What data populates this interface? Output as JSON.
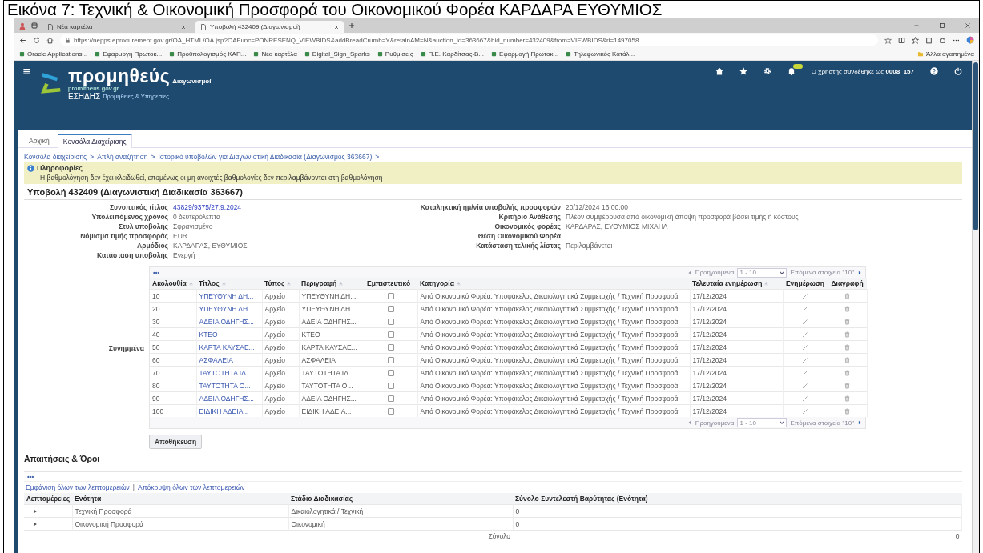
{
  "caption": "Εικόνα 7: Τεχνική & Οικονομική Προσφορά του Οικονομικού Φορέα ΚΑΡΔΑΡΑ ΕΥΘΥΜΙΟΣ",
  "browser": {
    "tabs": [
      {
        "title": "Νέα καρτέλα",
        "selected": false
      },
      {
        "title": "Υποβολή 432409 (Διαγωνισμοί)",
        "selected": true
      }
    ],
    "url": "https://nepps.eprocurement.gov.gr/OA_HTML/OA.jsp?OAFunc=PONRESENQ_VIEWBIDS&addBreadCrumb=Y&retainAM=N&auction_id=363667&bid_number=432409&from=VIEWBIDS&ri=1497058...",
    "bookmarks": [
      "Oracle Applications...",
      "Εφαρμογή Πρωτοκ...",
      "Προϋπολογισμός ΚΑΠ...",
      "Νέα καρτέλα",
      "Digital_Sign_Sparks",
      "Ρυθμίσεις",
      "Π.Ε. Καρδίτσας-Β...",
      "Εφαρμογή Πρωτοκ...",
      "Τηλεφωνικός Κατάλ..."
    ],
    "other_bookmarks": "Άλλα αγαπημένα"
  },
  "app": {
    "logo": "προμηθεύς",
    "logo_section": "Διαγωνισμοί",
    "logo_site": "promitheus.gov.gr",
    "logo_org": "ΕΣΗΔΗΣ",
    "logo_org_sub": "Προμήθειες & Υπηρεσίες",
    "user_text": "Ο χρήστης συνδέθηκε ως",
    "user_id": "0008_157"
  },
  "nav_tabs": [
    {
      "label": "Αρχική",
      "selected": false
    },
    {
      "label": "Κονσόλα Διαχείρισης",
      "selected": true
    }
  ],
  "breadcrumb": {
    "separator": ">",
    "items": [
      "Κονσόλα διαχείρισης",
      "Απλή αναζήτηση",
      "Ιστορικό υποβολών για Διαγωνιστική Διαδικασία (Διαγωνισμός 363667)"
    ]
  },
  "info": {
    "title": "Πληροφορίες",
    "message": "Η βαθμολόγηση δεν έχει κλειδωθεί, επομένως οι μη ανοιχτές βαθμολογίες δεν περιλαμβάνονται στη βαθμολόγηση"
  },
  "heading": "Υποβολή 432409 (Διαγωνιστική Διαδικασία 363667)",
  "details_left": [
    {
      "label": "Συνοπτικός τίτλος",
      "value": "43829/9375/27.9.2024",
      "kind": "link"
    },
    {
      "label": "Υπολειπόμενος χρόνος",
      "value": "0 δευτερόλεπτα",
      "kind": "text"
    },
    {
      "label": "Στυλ υποβολής",
      "value": "Σφραγισμένο",
      "kind": "text"
    },
    {
      "label": "Νόμισμα τιμής προσφοράς",
      "value": "EUR",
      "kind": "text"
    },
    {
      "label": "Αρμόδιος",
      "value": "ΚΑΡΔΑΡΑΣ, ΕΥΘΥΜΙΟΣ",
      "kind": "text"
    },
    {
      "label": "Κατάσταση υποβολής",
      "value": "Ενεργή",
      "kind": "text"
    }
  ],
  "details_right": [
    {
      "label": "Καταληκτική ημ/νία υποβολής προσφορών",
      "value": "20/12/2024 16:00:00",
      "kind": "text"
    },
    {
      "label": "Κριτήριο Ανάθεσης",
      "value": "Πλέον συμφέρουσα από οικονομική άποψη προσφορά βάσει τιμής ή κόστους",
      "kind": "text"
    },
    {
      "label": "Οικονομικός φορέας",
      "value": "ΚΑΡΔΑΡΑΣ, ΕΥΘΥΜΙΟΣ ΜΙΧΑΗΛ",
      "kind": "text"
    },
    {
      "label": "Θέση Οικονομικού Φορέα"
    },
    {
      "label": "Κατάσταση τελικής λίστας",
      "value": "Περιλαμβάνεται",
      "kind": "text"
    }
  ],
  "attachments": {
    "label": "Συνημμένα",
    "menu": "•••",
    "pager_top": {
      "previous": "Προηγούμενα",
      "range": "1 - 10",
      "next": "Επόμενα στοιχεία \"10\""
    },
    "pager_bottom": {
      "previous": "Προηγούμενα",
      "range": "1 - 10",
      "next": "Επόμενα στοιχεία \"10\""
    },
    "columns": [
      "Ακολουθία",
      "Τίτλος",
      "Τύπος",
      "Περιγραφή",
      "Εμπιστευτικό",
      "Κατηγορία",
      "Τελευταία ενημέρωση",
      "Ενημέρωση",
      "Διαγραφή"
    ],
    "rows": [
      {
        "seq": "10",
        "title": "ΥΠΕΥΘΥΝΗ ΔΗ...",
        "type": "Αρχείο",
        "description": "ΥΠΕΥΘΥΝΗ ΔΗ...",
        "checked": false,
        "category": "Από Οικονομικό Φορέα: Υποφάκελος Δικαιολογητικά Συμμετοχής / Τεχνική Προσφορά",
        "updated": "17/12/2024"
      },
      {
        "seq": "20",
        "title": "ΥΠΕΥΘΥΝΗ ΔΗ...",
        "type": "Αρχείο",
        "description": "ΥΠΕΥΘΥΝΗ ΔΗ...",
        "checked": false,
        "category": "Από Οικονομικό Φορέα: Υποφάκελος Δικαιολογητικά Συμμετοχής / Τεχνική Προσφορά",
        "updated": "17/12/2024"
      },
      {
        "seq": "30",
        "title": "ΑΔΕΙΑ ΟΔΗΓΗΣ...",
        "type": "Αρχείο",
        "description": "ΑΔΕΙΑ ΟΔΗΓΗΣ...",
        "checked": false,
        "category": "Από Οικονομικό Φορέα: Υποφάκελος Δικαιολογητικά Συμμετοχής / Τεχνική Προσφορά",
        "updated": "17/12/2024"
      },
      {
        "seq": "40",
        "title": "ΚΤΕΟ",
        "type": "Αρχείο",
        "description": "ΚΤΕΟ",
        "checked": false,
        "category": "Από Οικονομικό Φορέα: Υποφάκελος Δικαιολογητικά Συμμετοχής / Τεχνική Προσφορά",
        "updated": "17/12/2024"
      },
      {
        "seq": "50",
        "title": "ΚΑΡΤΑ ΚΑΥΣΑΕ...",
        "type": "Αρχείο",
        "description": "ΚΑΡΤΑ ΚΑΥΣΑΕ...",
        "checked": false,
        "category": "Από Οικονομικό Φορέα: Υποφάκελος Δικαιολογητικά Συμμετοχής / Τεχνική Προσφορά",
        "updated": "17/12/2024"
      },
      {
        "seq": "60",
        "title": "ΑΣΦΑΛΕΙΑ",
        "type": "Αρχείο",
        "description": "ΑΣΦΑΛΕΙΑ",
        "checked": false,
        "category": "Από Οικονομικό Φορέα: Υποφάκελος Δικαιολογητικά Συμμετοχής / Τεχνική Προσφορά",
        "updated": "17/12/2024"
      },
      {
        "seq": "70",
        "title": "ΤΑΥΤΟΤΗΤΑ ΙΔ...",
        "type": "Αρχείο",
        "description": "ΤΑΥΤΟΤΗΤΑ ΙΔ...",
        "checked": false,
        "category": "Από Οικονομικό Φορέα: Υποφάκελος Δικαιολογητικά Συμμετοχής / Τεχνική Προσφορά",
        "updated": "17/12/2024"
      },
      {
        "seq": "80",
        "title": "ΤΑΥΤΟΤΗΤΑ Ο...",
        "type": "Αρχείο",
        "description": "ΤΑΥΤΟΤΗΤΑ Ο...",
        "checked": false,
        "category": "Από Οικονομικό Φορέα: Υποφάκελος Δικαιολογητικά Συμμετοχής / Τεχνική Προσφορά",
        "updated": "17/12/2024"
      },
      {
        "seq": "90",
        "title": "ΑΔΕΙΑ ΟΔΗΓΗΣ...",
        "type": "Αρχείο",
        "description": "ΑΔΕΙΑ ΟΔΗΓΗΣ...",
        "checked": false,
        "category": "Από Οικονομικό Φορέα: Υποφάκελος Δικαιολογητικά Συμμετοχής / Τεχνική Προσφορά",
        "updated": "17/12/2024"
      },
      {
        "seq": "100",
        "title": "ΕΙΔΙΚΗ ΑΔΕΙΑ...",
        "type": "Αρχείο",
        "description": "ΕΙΔΙΚΗ ΑΔΕΙΑ...",
        "checked": false,
        "category": "Από Οικονομικό Φορέα: Υποφάκελος Δικαιολογητικά Συμμετοχής / Τεχνική Προσφορά",
        "updated": "17/12/2024"
      }
    ]
  },
  "save_button": "Αποθήκευση",
  "requirements": {
    "title": "Απαιτήσεις & Όροι",
    "menu": "•••",
    "show_all": "Εμφάνιση όλων των λεπτομερειών",
    "hide_all": "Απόκρυψη όλων των λεπτομερειών",
    "links_separator": "|",
    "columns": [
      "Λεπτομέρειες",
      "Ενότητα",
      "Στάδιο Διαδικασίας",
      "Σύνολο Συντελεστή Βαρύτητας (Ενότητα)"
    ],
    "rows": [
      {
        "expanded": false,
        "section": "Τεχνική Προσφορά",
        "stage": "Δικαιολογητικά / Τεχνική",
        "weight": "0"
      },
      {
        "expanded": false,
        "section": "Οικονομική Προσφορά",
        "stage": "Οικονομική",
        "weight": "0"
      }
    ],
    "total_label": "Σύνολο",
    "total_value": "0"
  }
}
